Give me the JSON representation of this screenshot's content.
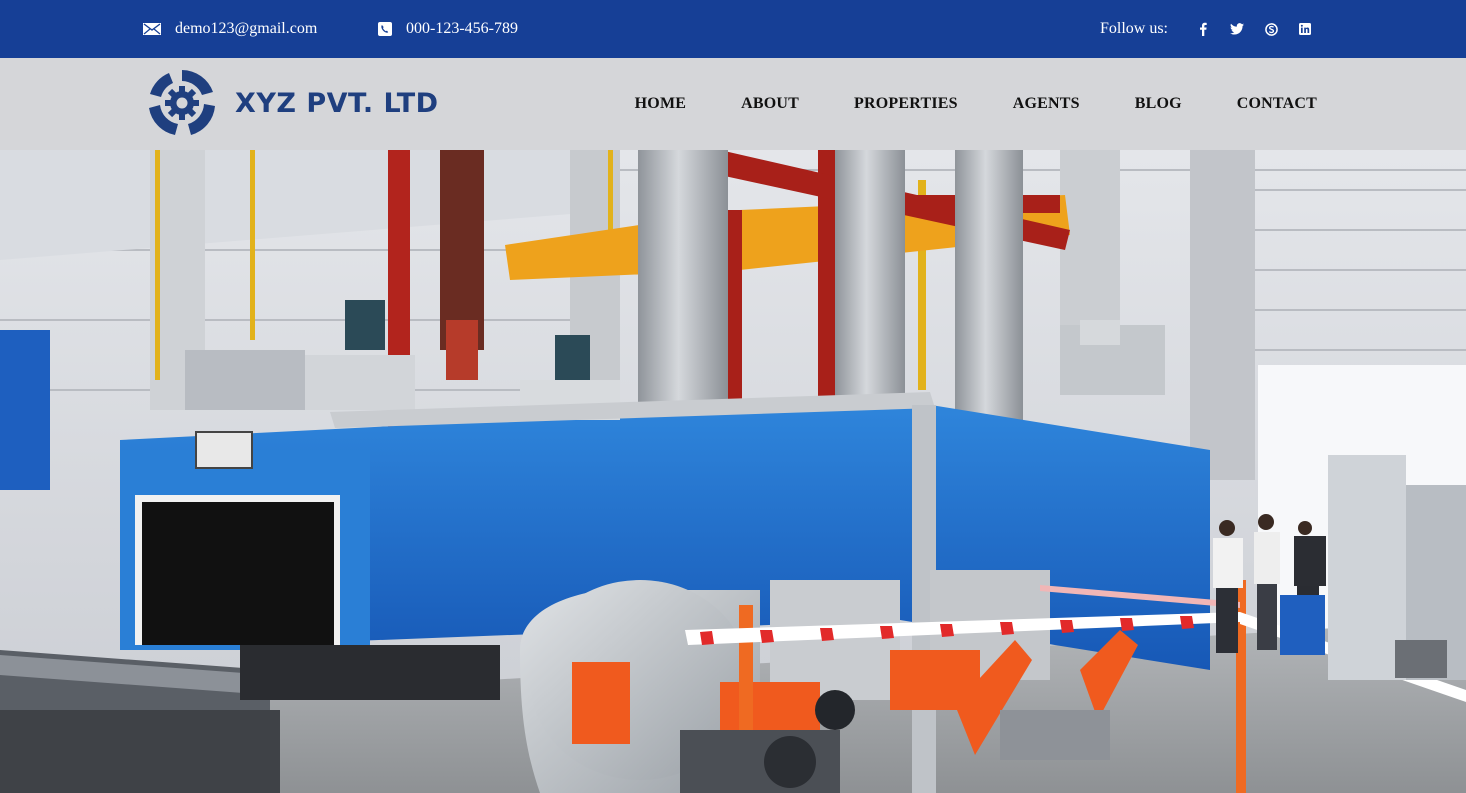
{
  "topbar": {
    "email": "demo123@gmail.com",
    "phone": "000-123-456-789",
    "follow_label": "Follow us:",
    "social": [
      {
        "icon": "facebook-icon",
        "glyph": "f"
      },
      {
        "icon": "twitter-icon",
        "glyph": "t"
      },
      {
        "icon": "skype-icon",
        "glyph": "s"
      },
      {
        "icon": "linkedin-icon",
        "glyph": "in"
      }
    ],
    "background": "#163f96"
  },
  "header": {
    "logo_text": "XYZ PVT. LTD",
    "logo_color": "#1f3f7f",
    "background": "#d5d6d9",
    "nav": [
      {
        "label": "HOME"
      },
      {
        "label": "ABOUT"
      },
      {
        "label": "PROPERTIES"
      },
      {
        "label": "AGENTS"
      },
      {
        "label": "BLOG"
      },
      {
        "label": "CONTACT"
      }
    ]
  },
  "hero": {
    "image": "industrial-furnace-production-line-photo"
  }
}
